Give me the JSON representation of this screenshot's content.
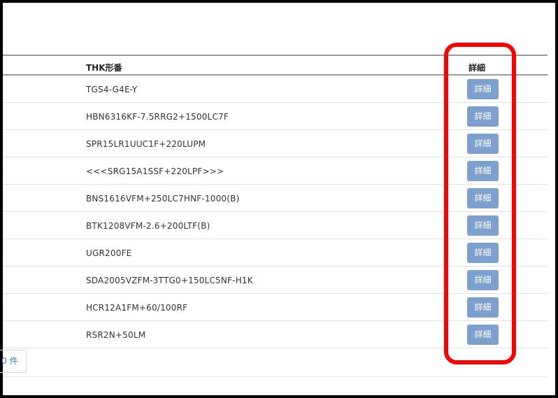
{
  "table": {
    "headers": {
      "part_number": "THK形番",
      "detail": "詳細"
    },
    "rows": [
      {
        "part_number": "TGS4-G4E-Y",
        "detail_label": "詳細"
      },
      {
        "part_number": "HBN6316KF-7.5RRG2+1500LC7F",
        "detail_label": "詳細"
      },
      {
        "part_number": "SPR15LR1UUC1F+220LUPM",
        "detail_label": "詳細"
      },
      {
        "part_number": "<<<SRG15A1SSF+220LPF>>>",
        "detail_label": "詳細"
      },
      {
        "part_number": "BNS1616VFM+250LC7HNF-1000(B)",
        "detail_label": "詳細"
      },
      {
        "part_number": "BTK1208VFM-2.6+200LTF(B)",
        "detail_label": "詳細"
      },
      {
        "part_number": "UGR200FE",
        "detail_label": "詳細"
      },
      {
        "part_number": "SDA2005VZFM-3TTG0+150LC5NF-H1K",
        "detail_label": "詳細"
      },
      {
        "part_number": "HCR12A1FM+60/100RF",
        "detail_label": "詳細"
      },
      {
        "part_number": "RSR2N+50LM",
        "detail_label": "詳細"
      }
    ]
  },
  "pagination": {
    "count_text": "0 件"
  },
  "colors": {
    "button": "#7da0cf",
    "highlight": "#ff0000",
    "link": "#2a7fd2"
  }
}
